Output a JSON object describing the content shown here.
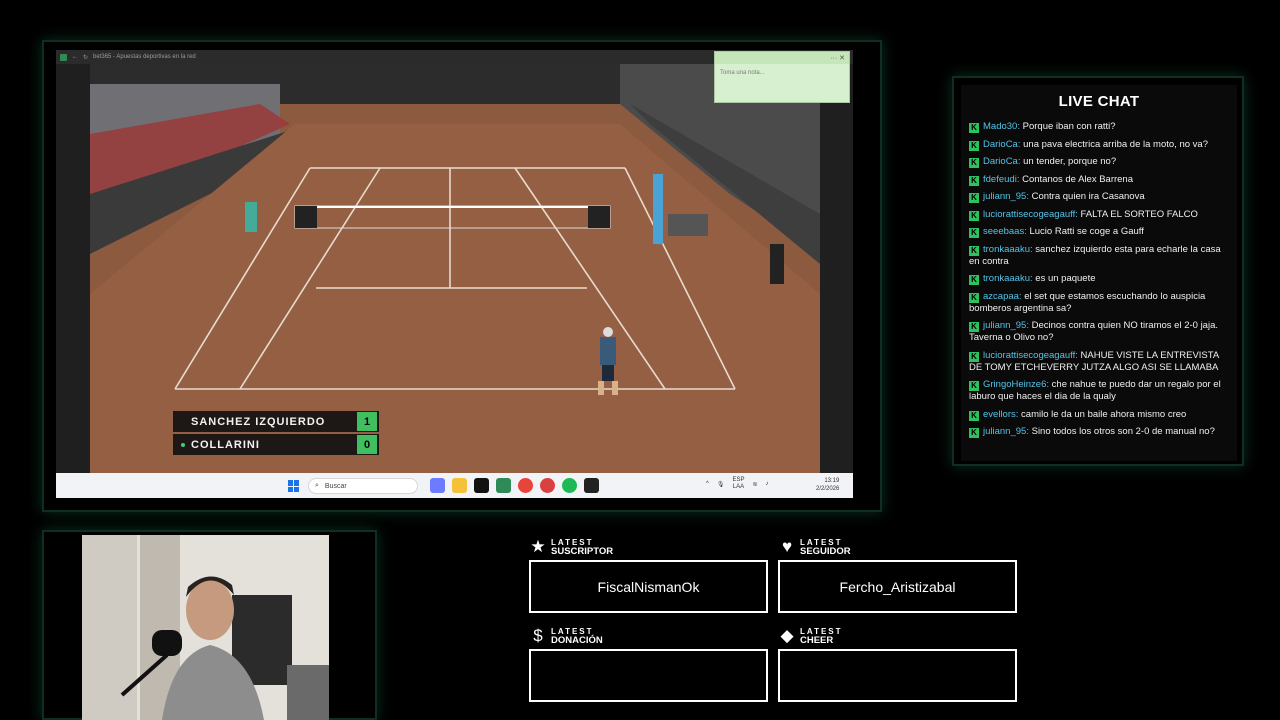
{
  "browser": {
    "tab_title": "bet365 - Apuestas deportivas en la red"
  },
  "scoreboard": {
    "players": [
      {
        "name": "SANCHEZ IZQUIERDO",
        "score": "1",
        "serving": false
      },
      {
        "name": "COLLARINI",
        "score": "0",
        "serving": true
      }
    ]
  },
  "note": {
    "placeholder": "Toma una nota...",
    "controls": "···  ✕"
  },
  "taskbar": {
    "search_placeholder": "Buscar",
    "language_top": "ESP",
    "language_bottom": "LAA",
    "time": "13:19",
    "date": "2/2/2026"
  },
  "chat": {
    "title": "LIVE CHAT",
    "badge_glyph": "K",
    "messages": [
      {
        "user": "Mado30",
        "text": "Porque iban con ratti?"
      },
      {
        "user": "DarioCa",
        "text": "una pava electrica arriba de la moto, no va?"
      },
      {
        "user": "DarioCa",
        "text": "un tender, porque no?"
      },
      {
        "user": "fdefeudi",
        "text": "Contanos de Alex Barrena"
      },
      {
        "user": "juliann_95",
        "text": "Contra quien ira Casanova"
      },
      {
        "user": "luciorattisecogeagauff",
        "text": "FALTA EL SORTEO FALCO"
      },
      {
        "user": "seeebaas",
        "text": "Lucio Ratti se coge a Gauff"
      },
      {
        "user": "tronkaaaku",
        "text": "sanchez izquierdo esta para echarle la casa en contra"
      },
      {
        "user": "tronkaaaku",
        "text": "es un paquete"
      },
      {
        "user": "azcapaa",
        "text": "el set que estamos escuchando lo auspicia bomberos argentina sa?"
      },
      {
        "user": "juliann_95",
        "text": "Decinos contra quien NO tiramos el 2-0 jaja. Taverna o Olivo no?"
      },
      {
        "user": "luciorattisecogeagauff",
        "text": "NAHUE VISTE LA ENTREVISTA DE TOMY ETCHEVERRY JUTZA ALGO ASI SE LLAMABA"
      },
      {
        "user": "GringoHeinze6",
        "text": "che nahue te puedo dar un regalo por el laburo que haces el dia de la qualy"
      },
      {
        "user": "evellors",
        "text": "camilo le da un baile ahora mismo creo"
      },
      {
        "user": "juliann_95",
        "text": "Sino todos los otros son 2-0 de manual no?"
      }
    ]
  },
  "widgets": {
    "suscriptor": {
      "small": "LATEST",
      "big": "SUSCRIPTOR",
      "value": "FiscalNismanOk",
      "icon": "★"
    },
    "seguidor": {
      "small": "LATEST",
      "big": "SEGUIDOR",
      "value": "Fercho_Aristizabal",
      "icon": "♥"
    },
    "donacion": {
      "small": "LATEST",
      "big": "DONACIÓN",
      "value": "",
      "icon": "$"
    },
    "cheer": {
      "small": "LATEST",
      "big": "CHEER",
      "value": "",
      "icon": "◆"
    }
  },
  "colors": {
    "accent_green": "#2ec25e",
    "chat_user": "#54c4e8",
    "frame_glow": "#0f2f22"
  }
}
